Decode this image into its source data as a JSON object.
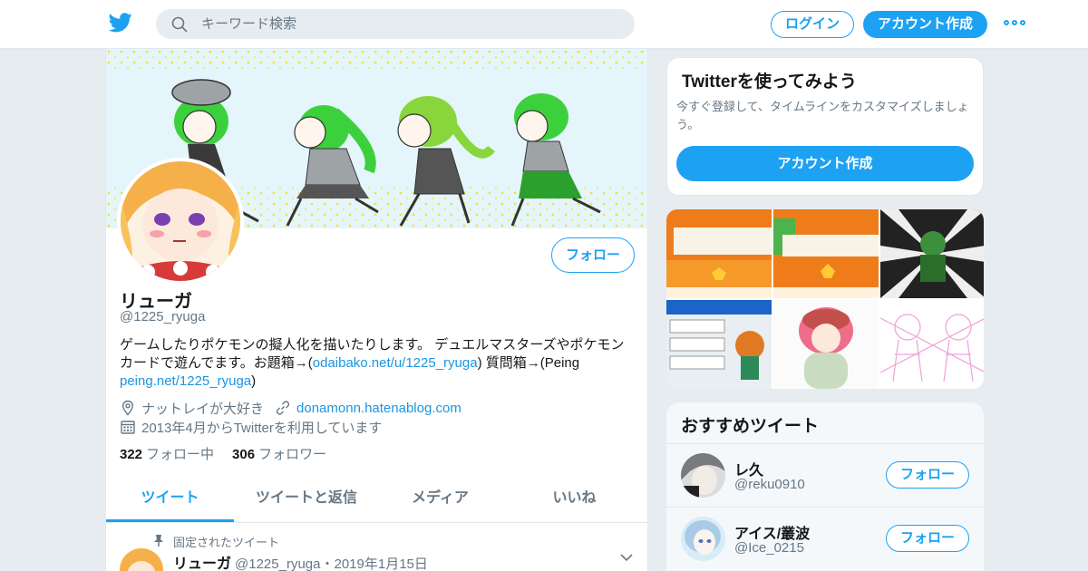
{
  "header": {
    "search_placeholder": "キーワード検索",
    "login_label": "ログイン",
    "signup_label": "アカウント作成"
  },
  "profile": {
    "name": "リューガ",
    "handle": "@1225_ryuga",
    "follow_label": "フォロー",
    "bio_text_1": "ゲームしたりポケモンの擬人化を描いたりします。 デュエルマスターズやポケモンカードで遊んでます。お題箱→(",
    "bio_link_1": "odaibako.net/u/1225_ryuga",
    "bio_text_2": ") 質問箱→(Peing ",
    "bio_link_2": "peing.net/1225_ryuga",
    "bio_text_3": ")",
    "location": "ナットレイが大好き",
    "website": "donamonn.hatenablog.com",
    "joined": "2013年4月からTwitterを利用しています",
    "following_count": "322",
    "following_label": "フォロー中",
    "followers_count": "306",
    "followers_label": "フォロワー",
    "tabs": [
      {
        "label": "ツイート"
      },
      {
        "label": "ツイートと返信"
      },
      {
        "label": "メディア"
      },
      {
        "label": "いいね"
      }
    ],
    "pinned_label": "固定されたツイート",
    "pinned_tweet": {
      "name": "リューガ",
      "handle": "@1225_ryuga",
      "separator": "・",
      "date": "2019年1月15日"
    }
  },
  "signup_card": {
    "title": "Twitterを使ってみよう",
    "description": "今すぐ登録して、タイムラインをカスタマイズしましょう。",
    "button_label": "アカウント作成"
  },
  "recommendations": {
    "title": "おすすめツイート",
    "items": [
      {
        "name": "レ久",
        "handle": "@reku0910",
        "follow_label": "フォロー"
      },
      {
        "name": "アイス/叢波",
        "handle": "@Ice_0215",
        "follow_label": "フォロー"
      }
    ]
  },
  "colors": {
    "accent": "#1da1f2",
    "link": "#1b95e0",
    "text_primary": "#14171a",
    "text_secondary": "#657786",
    "background": "#e6ecf0"
  }
}
